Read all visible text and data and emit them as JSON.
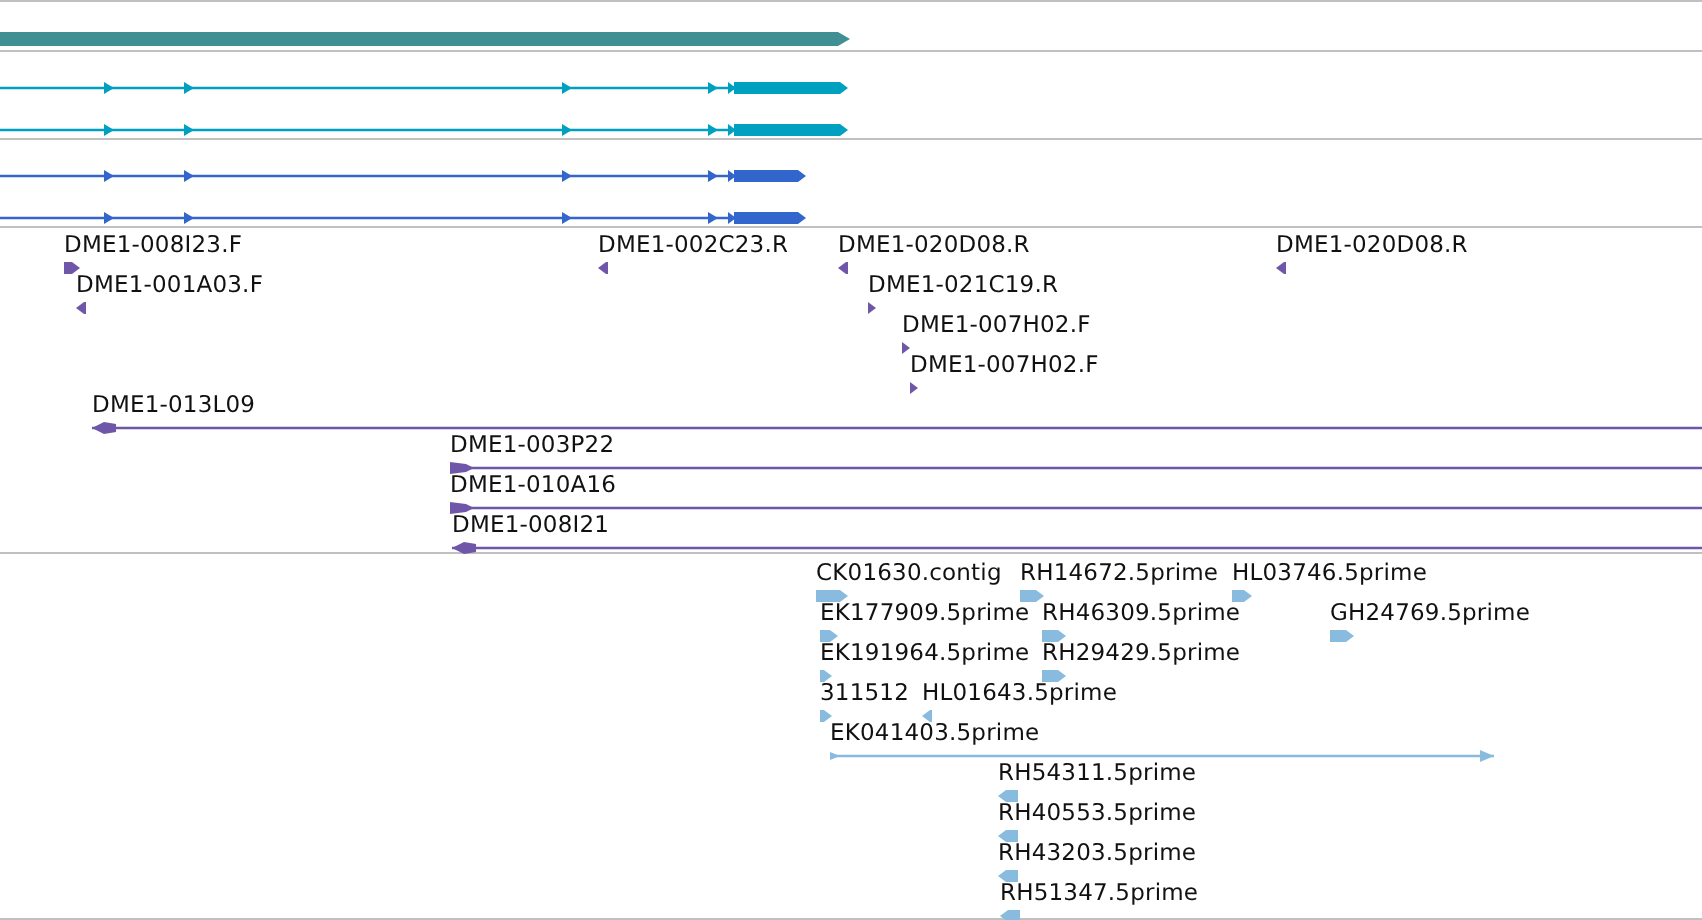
{
  "tracks": [
    {
      "kind": "bar",
      "color": "#3f8f93",
      "reverse": false
    },
    {
      "kind": "transcripts",
      "color": "#00a0c0",
      "transcripts": [
        {
          "reverse": false
        },
        {
          "reverse": false
        }
      ]
    },
    {
      "kind": "transcripts",
      "color": "#3366cc",
      "transcripts": [
        {
          "reverse": false
        },
        {
          "reverse": false
        }
      ]
    },
    {
      "kind": "features",
      "color": "#7056a8",
      "features": [
        {
          "label": "DME1-008I23.F",
          "reverse": false,
          "kind": "read"
        },
        {
          "label": "DME1-001A03.F",
          "reverse": true,
          "kind": "read"
        },
        {
          "label": "DME1-002C23.R",
          "reverse": true,
          "kind": "read"
        },
        {
          "label": "DME1-020D08.R",
          "reverse": true,
          "kind": "read"
        },
        {
          "label": "DME1-021C19.R",
          "reverse": false,
          "kind": "read"
        },
        {
          "label": "DME1-007H02.F",
          "reverse": false,
          "kind": "read"
        },
        {
          "label": "DME1-007H02.F",
          "reverse": false,
          "kind": "read"
        },
        {
          "label": "DME1-020D08.R",
          "reverse": true,
          "kind": "read"
        },
        {
          "label": "DME1-013L09",
          "reverse": true,
          "kind": "span"
        },
        {
          "label": "DME1-003P22",
          "reverse": false,
          "kind": "span"
        },
        {
          "label": "DME1-010A16",
          "reverse": false,
          "kind": "span"
        },
        {
          "label": "DME1-008I21",
          "reverse": true,
          "kind": "span"
        }
      ]
    },
    {
      "kind": "features",
      "color": "#88bbdd",
      "features": [
        {
          "label": "CK01630.contig",
          "reverse": false,
          "kind": "read"
        },
        {
          "label": "RH14672.5prime",
          "reverse": false,
          "kind": "read"
        },
        {
          "label": "HL03746.5prime",
          "reverse": false,
          "kind": "read"
        },
        {
          "label": "EK177909.5prime",
          "reverse": false,
          "kind": "read"
        },
        {
          "label": "RH46309.5prime",
          "reverse": false,
          "kind": "read"
        },
        {
          "label": "GH24769.5prime",
          "reverse": false,
          "kind": "read"
        },
        {
          "label": "EK191964.5prime",
          "reverse": false,
          "kind": "read"
        },
        {
          "label": "RH29429.5prime",
          "reverse": false,
          "kind": "read"
        },
        {
          "label": "311512",
          "reverse": false,
          "kind": "read"
        },
        {
          "label": "HL01643.5prime",
          "reverse": true,
          "kind": "read"
        },
        {
          "label": "EK041403.5prime",
          "reverse": false,
          "kind": "span"
        },
        {
          "label": "RH54311.5prime",
          "reverse": true,
          "kind": "read"
        },
        {
          "label": "RH40553.5prime",
          "reverse": true,
          "kind": "read"
        },
        {
          "label": "RH43203.5prime",
          "reverse": true,
          "kind": "read"
        },
        {
          "label": "RH51347.5prime",
          "reverse": true,
          "kind": "read"
        }
      ]
    }
  ]
}
